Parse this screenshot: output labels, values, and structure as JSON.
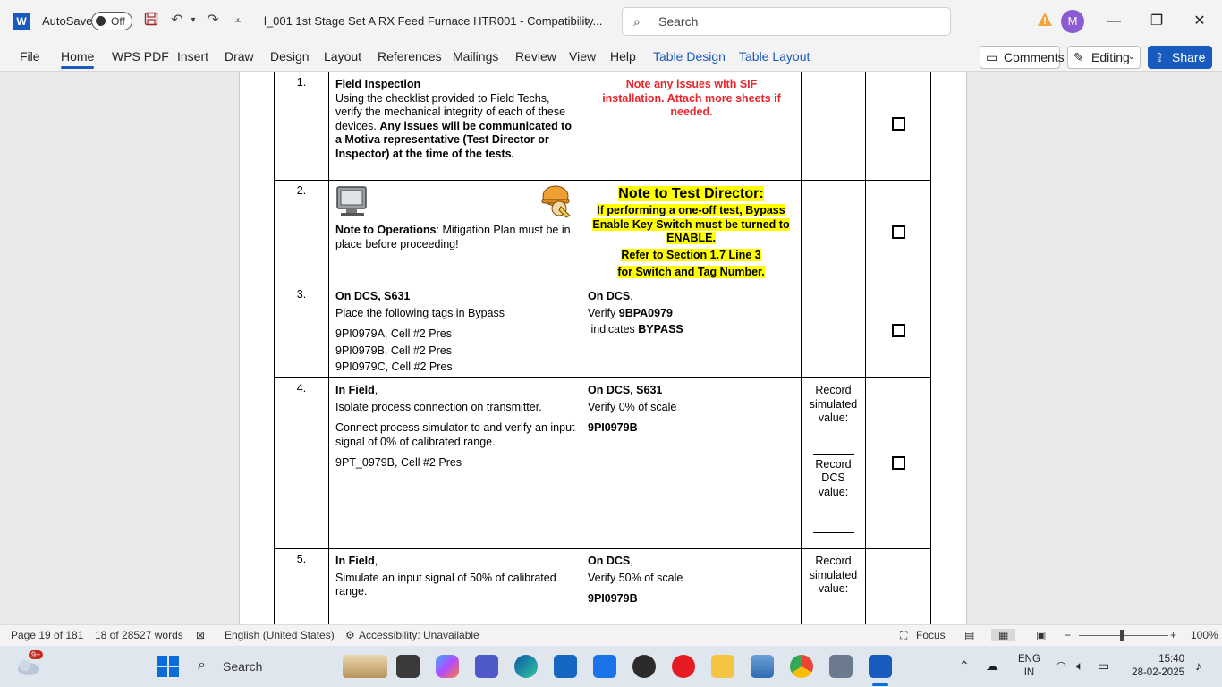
{
  "titlebar": {
    "autosave_label": "AutoSave",
    "autosave_state": "Off",
    "doc_title": "l_001 1st Stage Set A RX Feed Furnace HTR001 - Compatibility...",
    "search_placeholder": "Search",
    "avatar_initial": "M"
  },
  "ribbon": {
    "tabs": [
      "File",
      "Home",
      "WPS PDF",
      "Insert",
      "Draw",
      "Design",
      "Layout",
      "References",
      "Mailings",
      "Review",
      "View",
      "Help",
      "Table Design",
      "Table Layout"
    ],
    "active_tab": "Home",
    "comments_label": "Comments",
    "editing_label": "Editing",
    "share_label": "Share"
  },
  "rows": [
    {
      "num": "1.",
      "step_title": "Field Inspection",
      "step_text_1": "Using the checklist provided to Field Techs, verify the mechanical integrity of each of these devices.",
      "step_text_bold": "Any issues will be communicated to a Motiva representative (Test Director or Inspector) at the time of the tests.",
      "verify_red": "Note any issues with SIF installation. Attach more sheets if needed."
    },
    {
      "num": "2.",
      "step_bold": "Note to Operations",
      "step_text": ": Mitigation Plan must be in place before proceeding!",
      "hl_title": "Note to Test Director:",
      "hl_text_1": "If performing a one-off test, Bypass Enable Key Switch must be turned to ENABLE.",
      "hl_text_2": "Refer to Section 1.7 Line 3",
      "hl_text_3": "for Switch and Tag Number."
    },
    {
      "num": "3.",
      "step_title": "On DCS, S631",
      "step_text": "Place the following tags in Bypass",
      "tags": [
        "9PI0979A, Cell #2 Pres",
        "9PI0979B, Cell #2 Pres",
        "9PI0979C, Cell #2 Pres"
      ],
      "verify_title": "On DCS",
      "verify_comma": ",",
      "verify_pre": "Verify ",
      "verify_tag": "9BPA0979",
      "verify_pre2": " indicates ",
      "verify_state": "BYPASS"
    },
    {
      "num": "4.",
      "step_title": "In Field",
      "step_comma": ",",
      "step_text_1": "Isolate process connection on transmitter.",
      "step_text_2": "Connect process simulator to and verify an input signal of 0% of calibrated range.",
      "step_text_3": "9PT_0979B, Cell #2 Pres",
      "verify_title": "On DCS, S631",
      "verify_text": "Verify 0% of scale",
      "verify_tag": "9PI0979B",
      "rec_1": "Record simulated value:",
      "rec_2": "Record DCS value:"
    },
    {
      "num": "5.",
      "step_title": "In Field",
      "step_comma": ",",
      "step_text": "Simulate an input signal of 50% of calibrated range.",
      "verify_title": "On DCS",
      "verify_comma": ",",
      "verify_text": "Verify 50% of scale",
      "verify_tag": "9PI0979B",
      "rec_1": "Record simulated value:"
    }
  ],
  "statusbar": {
    "page": "Page 19 of 181",
    "words": "18 of 28527 words",
    "language": "English (United States)",
    "accessibility": "Accessibility: Unavailable",
    "focus": "Focus",
    "zoom": "100%"
  },
  "taskbar": {
    "search_label": "Search",
    "notif_badge": "9+",
    "lang_1": "ENG",
    "lang_2": "IN",
    "time": "15:40",
    "date": "28-02-2025"
  },
  "colors": {
    "word_blue": "#185abd",
    "red_note": "#e8262c",
    "highlight": "#ffff00"
  }
}
